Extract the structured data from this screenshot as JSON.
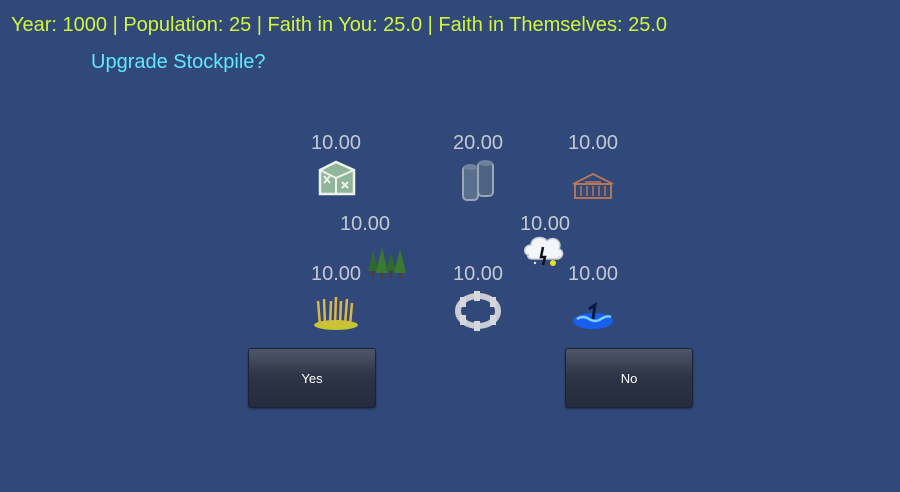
{
  "hud": {
    "status": "Year: 1000 | Population: 25 | Faith in You: 25.0 | Faith in Themselves: 25.0",
    "prompt": "Upgrade Stockpile?"
  },
  "resources": [
    {
      "icon": "hut-icon",
      "value": "10.00"
    },
    {
      "icon": "barrels-icon",
      "value": "20.00"
    },
    {
      "icon": "building-icon",
      "value": "10.00"
    },
    {
      "icon": "trees-icon",
      "value": "10.00"
    },
    {
      "icon": "storm-cloud-icon",
      "value": "10.00"
    },
    {
      "icon": "wheat-icon",
      "value": "10.00"
    },
    {
      "icon": "stone-ring-icon",
      "value": "10.00"
    },
    {
      "icon": "water-icon",
      "value": "10.00"
    }
  ],
  "buttons": {
    "yes": "Yes",
    "no": "No"
  }
}
